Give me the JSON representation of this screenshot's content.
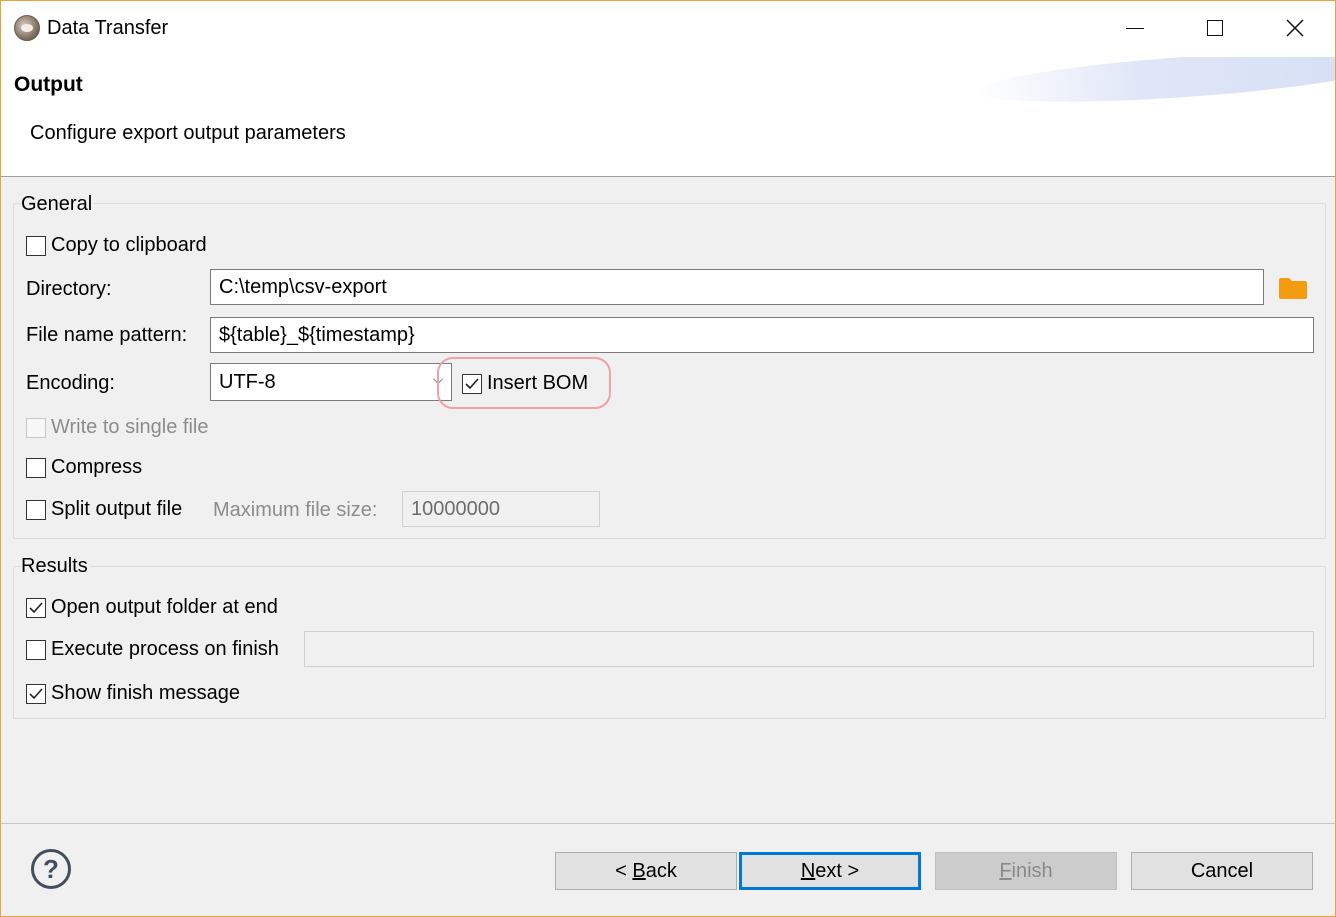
{
  "window": {
    "title": "Data Transfer",
    "minimize_icon": "minimize-icon",
    "maximize_icon": "maximize-icon",
    "close_icon": "close-icon"
  },
  "header": {
    "title": "Output",
    "description": "Configure export output parameters"
  },
  "general": {
    "group_title": "General",
    "copy_to_clipboard": {
      "label": "Copy to clipboard",
      "checked": false
    },
    "directory": {
      "label": "Directory:",
      "value": "C:\\temp\\csv-export"
    },
    "file_name_pattern": {
      "label": "File name pattern:",
      "value": "${table}_${timestamp}"
    },
    "encoding": {
      "label": "Encoding:",
      "value": "UTF-8"
    },
    "insert_bom": {
      "label": "Insert BOM",
      "checked": true
    },
    "write_single_file": {
      "label": "Write to single file",
      "checked": false,
      "enabled": false
    },
    "compress": {
      "label": "Compress",
      "checked": false
    },
    "split_output": {
      "label": "Split output file",
      "checked": false
    },
    "max_file_size": {
      "label": "Maximum file size:",
      "value": "10000000",
      "enabled": false
    }
  },
  "results": {
    "group_title": "Results",
    "open_output_folder": {
      "label": "Open output folder at end",
      "checked": true
    },
    "execute_process": {
      "label": "Execute process on finish",
      "checked": false,
      "value": ""
    },
    "show_finish_message": {
      "label": "Show finish message",
      "checked": true
    }
  },
  "footer": {
    "help_icon": "help-icon",
    "back": {
      "prefix": "< ",
      "mnemonic": "B",
      "rest": "ack"
    },
    "next": {
      "mnemonic": "N",
      "rest": "ext >"
    },
    "finish": {
      "mnemonic": "F",
      "rest": "inish",
      "enabled": false
    },
    "cancel": "Cancel"
  },
  "colors": {
    "window_border": "#e8a33c",
    "folder_icon": "#f39c12",
    "highlight": "#f0a0a8",
    "default_button_border": "#0078d7"
  }
}
